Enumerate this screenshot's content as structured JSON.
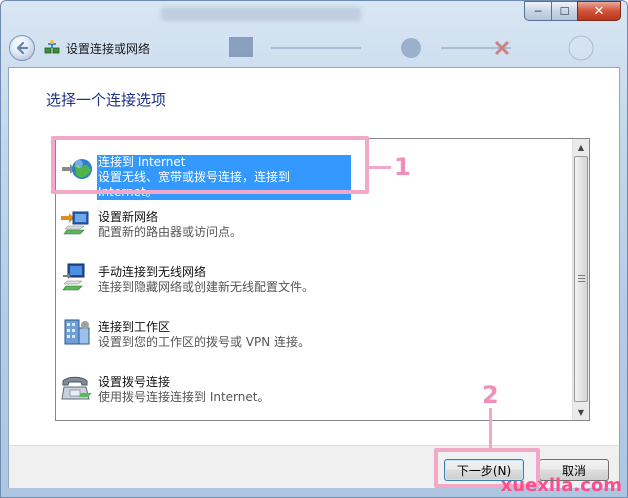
{
  "window": {
    "nav_title": "设置连接或网络",
    "close_glyph": "✕",
    "minimize_glyph": "─",
    "maximize_glyph": "☐"
  },
  "heading": "选择一个连接选项",
  "options": [
    {
      "title": "连接到 Internet",
      "desc": "设置无线、宽带或拨号连接，连接到 Internet。",
      "icon": "globe-icon",
      "selected": true
    },
    {
      "title": "设置新网络",
      "desc": "配置新的路由器或访问点。",
      "icon": "router-icon",
      "selected": false
    },
    {
      "title": "手动连接到无线网络",
      "desc": "连接到隐藏网络或创建新无线配置文件。",
      "icon": "wireless-icon",
      "selected": false
    },
    {
      "title": "连接到工作区",
      "desc": "设置到您的工作区的拨号或 VPN 连接。",
      "icon": "workplace-icon",
      "selected": false
    },
    {
      "title": "设置拨号连接",
      "desc": "使用拨号连接连接到 Internet。",
      "icon": "dialup-icon",
      "selected": false
    }
  ],
  "buttons": {
    "next": "下一步(N)",
    "cancel": "取消"
  },
  "annotations": {
    "marker1": "1",
    "marker2": "2"
  },
  "watermark": "xuexila.com",
  "colors": {
    "selection": "#3399ff",
    "heading": "#1e3287",
    "highlight": "#f2a9c8"
  }
}
